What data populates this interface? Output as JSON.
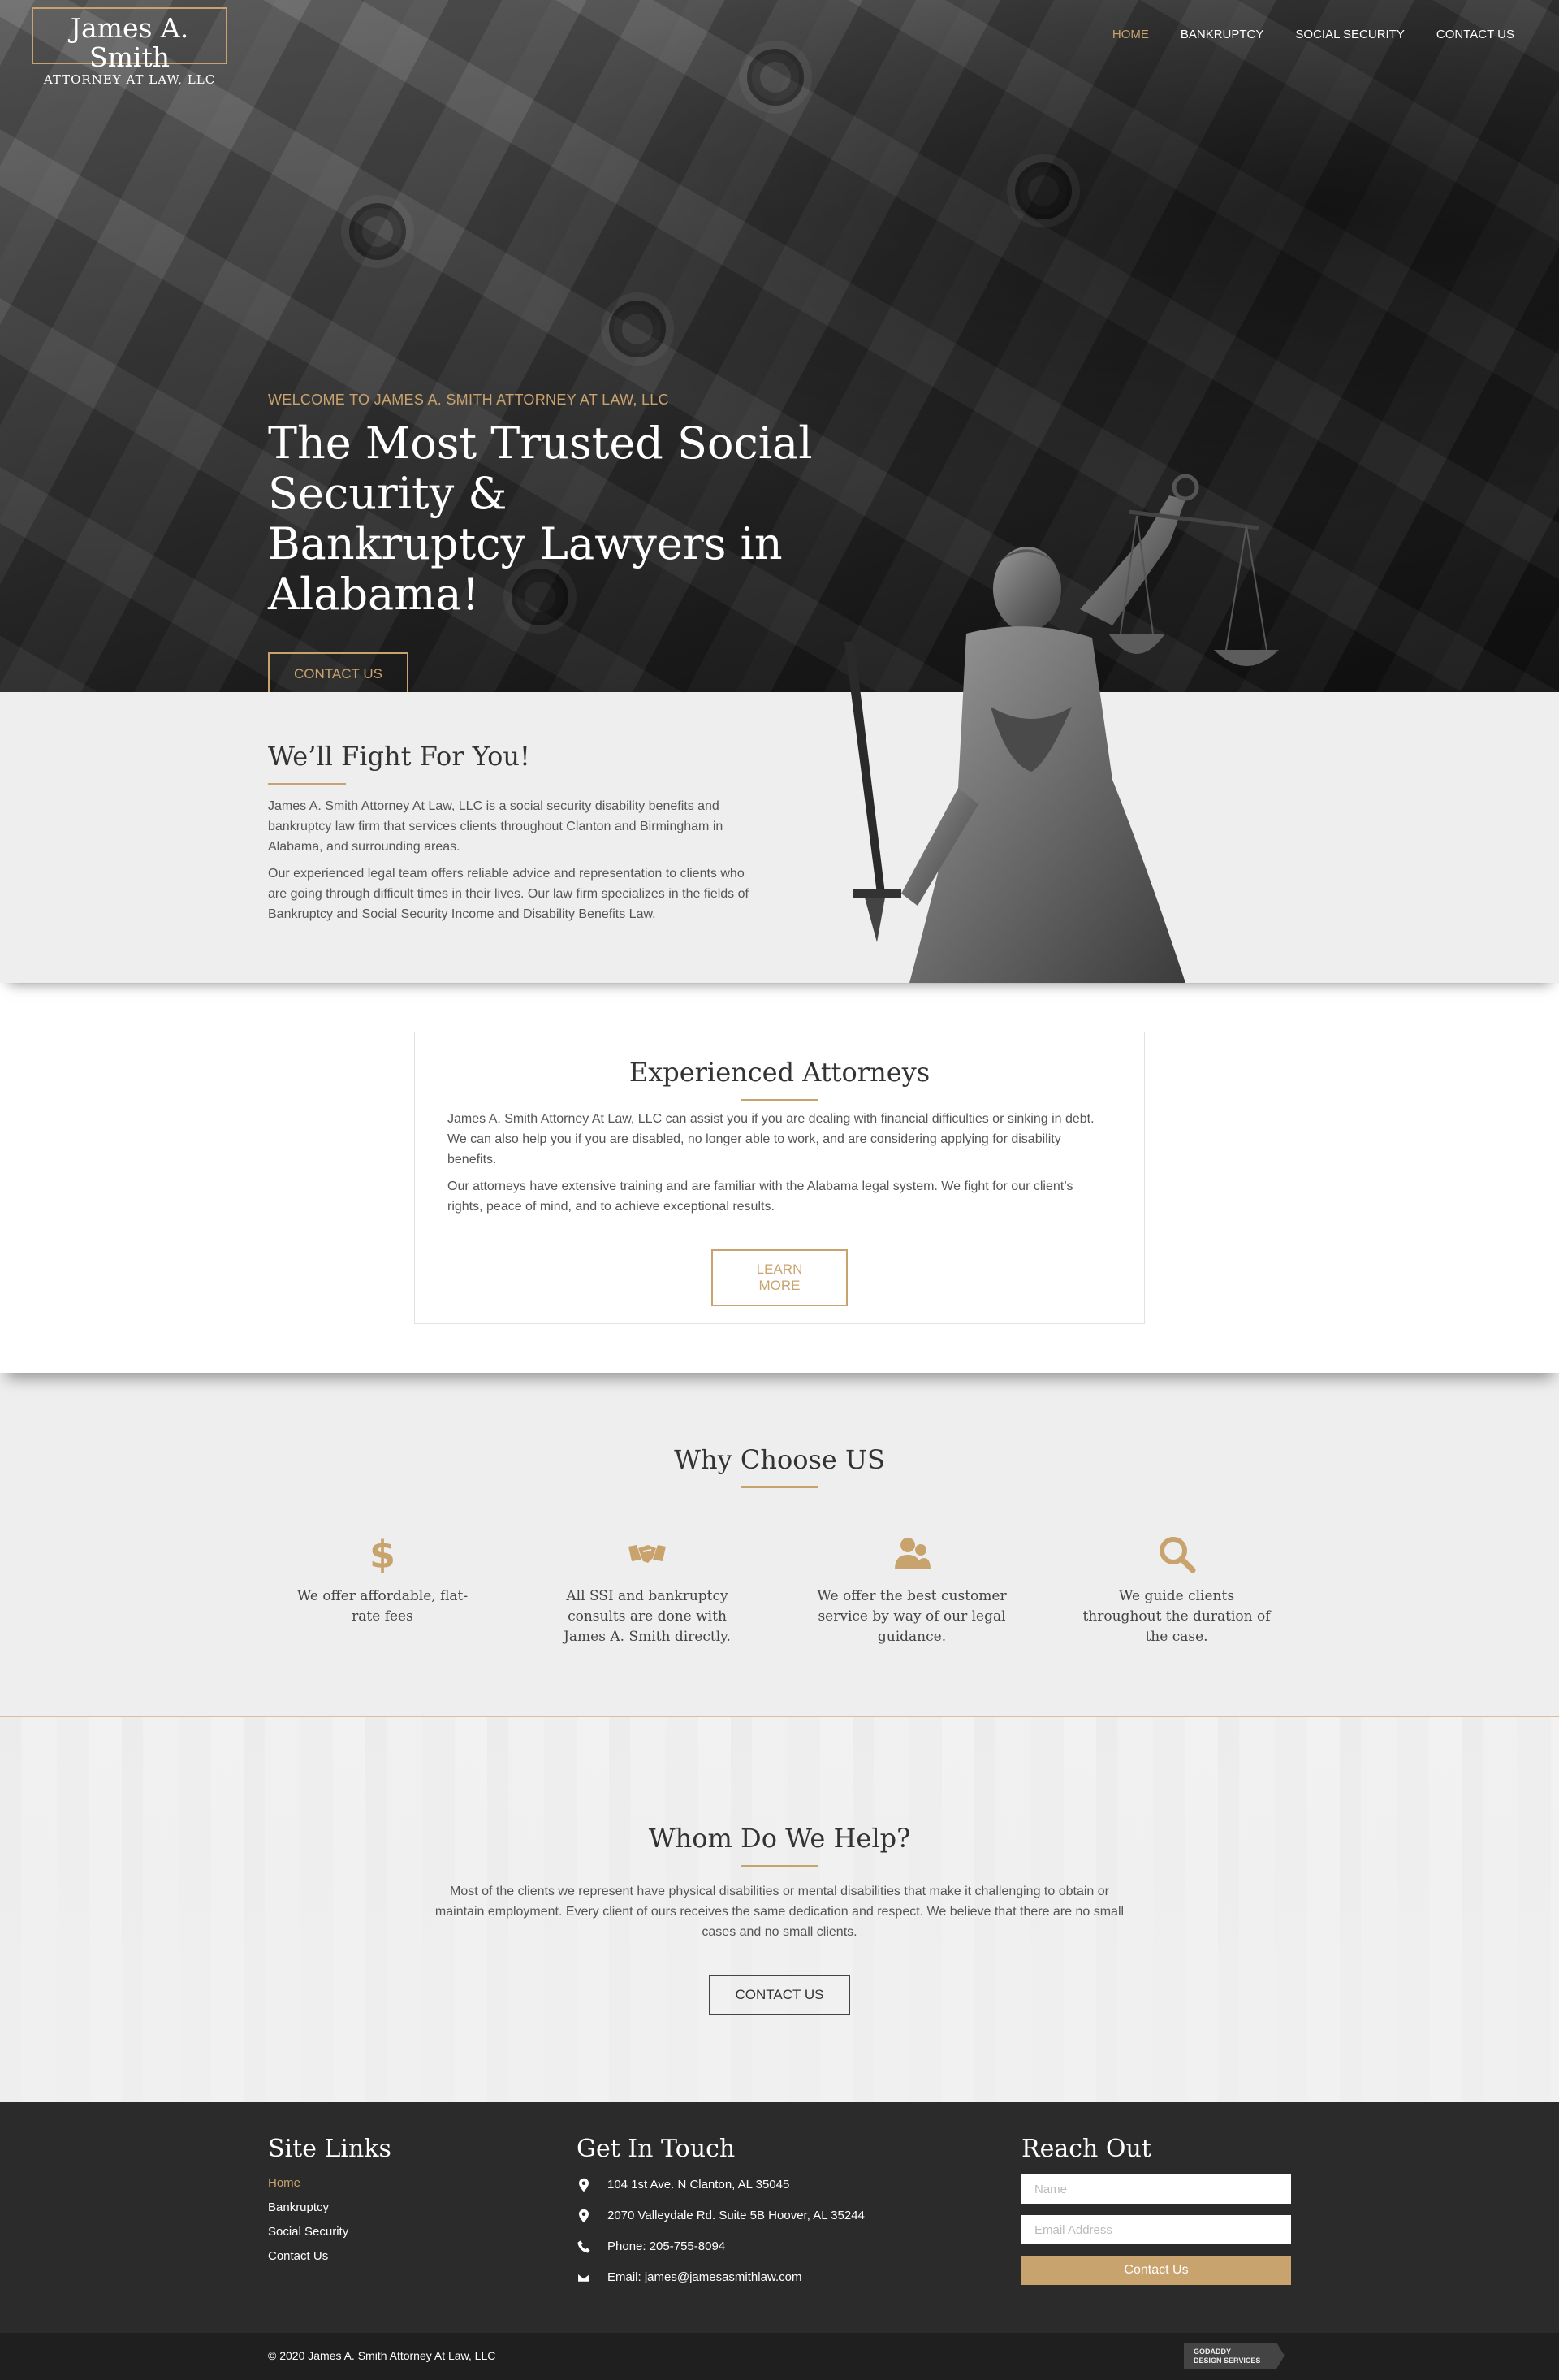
{
  "logo": {
    "name": "James A. Smith",
    "subtitle": "ATTORNEY AT LAW, LLC"
  },
  "nav": {
    "items": [
      "HOME",
      "BANKRUPTCY",
      "SOCIAL SECURITY",
      "CONTACT US"
    ],
    "active_index": 0
  },
  "hero": {
    "eyebrow": "WELCOME TO JAMES A. SMITH ATTORNEY AT LAW, LLC",
    "title_line1": "The Most Trusted Social Security &",
    "title_line2": "Bankruptcy Lawyers in Alabama!",
    "button_label": "CONTACT US"
  },
  "fight": {
    "title": "We’ll Fight For You!",
    "para1": "James A. Smith Attorney At Law, LLC is a social security disability benefits and bankruptcy law firm that services clients throughout Clanton and Birmingham in Alabama, and surrounding areas.",
    "para2": "Our experienced legal team offers reliable advice and representation to clients who are going through difficult times in their lives. Our law firm specializes in the fields of Bankruptcy and Social Security Income and Disability Benefits Law."
  },
  "experienced": {
    "title": "Experienced Attorneys",
    "para1": "James A. Smith Attorney At Law, LLC can assist you if you are dealing with financial difficulties or sinking in debt. We can also help you if you are disabled, no longer able to work, and are considering applying for disability benefits.",
    "para2": "Our attorneys have extensive training and are familiar with the Alabama legal system. We fight for our client’s rights, peace of mind, and to achieve exceptional results.",
    "button_label": "LEARN MORE"
  },
  "why": {
    "title": "Why Choose US",
    "items": [
      {
        "icon": "dollar-icon",
        "text": "We offer affordable, flat-rate fees"
      },
      {
        "icon": "handshake-icon",
        "text": "All SSI and bankruptcy consults are done with James A. Smith directly."
      },
      {
        "icon": "users-icon",
        "text": "We offer the best customer service by way of our legal guidance."
      },
      {
        "icon": "search-icon",
        "text": "We guide clients throughout the duration of the case."
      }
    ]
  },
  "whom": {
    "title": "Whom Do We Help?",
    "para": "Most of the clients we represent have physical disabilities or mental disabilities that make it challenging to obtain or maintain employment. Every client of ours receives the same dedication and respect. We believe that there are no small cases and no small clients.",
    "button_label": "CONTACT US"
  },
  "footer": {
    "site_links": {
      "title": "Site Links",
      "items": [
        "Home",
        "Bankruptcy",
        "Social Security",
        "Contact Us"
      ],
      "active_index": 0
    },
    "contact": {
      "title": "Get In Touch",
      "address1": "104 1st Ave. N Clanton, AL 35045",
      "address2": "2070 Valleydale Rd. Suite 5B Hoover, AL 35244",
      "phone": "Phone: 205-755-8094",
      "email": "Email: james@jamesasmithlaw.com"
    },
    "reach_out": {
      "title": "Reach Out",
      "name_placeholder": "Name",
      "email_placeholder": "Email Address",
      "button_label": "Contact Us"
    },
    "copyright": "© 2020 James A. Smith Attorney At Law, LLC",
    "badge_line1": "GODADDY",
    "badge_line2": "DESIGN SERVICES"
  },
  "colors": {
    "accent": "#c9a36d",
    "footer_bg": "#2b2b2b",
    "section_bg": "#eeeeee"
  }
}
